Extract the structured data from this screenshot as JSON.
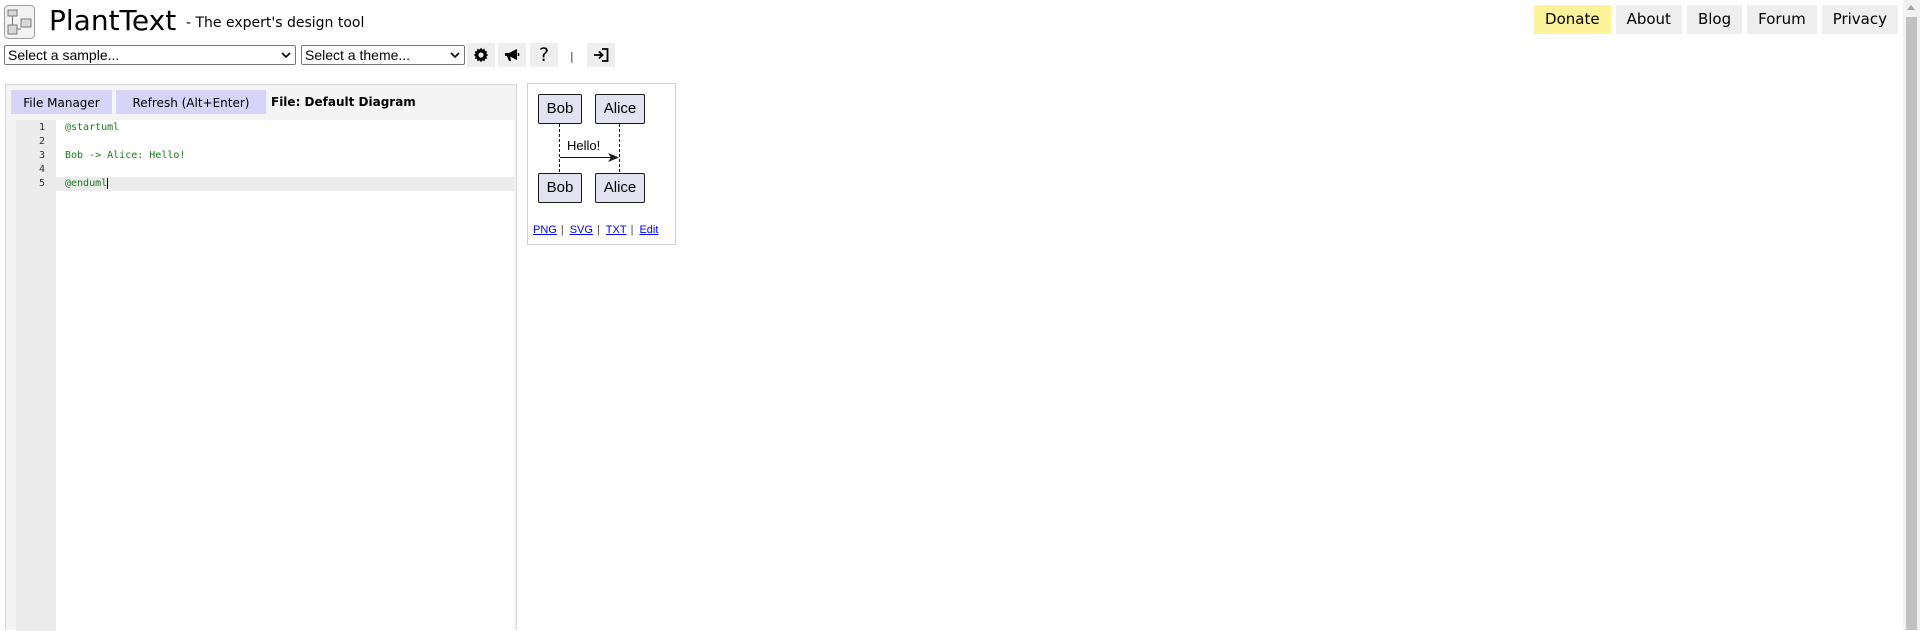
{
  "header": {
    "app_title": "PlantText",
    "tagline": "- The expert's design tool",
    "nav": [
      {
        "label": "Donate"
      },
      {
        "label": "About"
      },
      {
        "label": "Blog"
      },
      {
        "label": "Forum"
      },
      {
        "label": "Privacy"
      }
    ]
  },
  "toolbar": {
    "sample_select": "Select a sample...",
    "theme_select": "Select a theme...",
    "help_label": "?",
    "separator": "|",
    "icons": [
      "gear-icon",
      "megaphone-icon",
      "help-icon",
      "login-icon"
    ]
  },
  "editor": {
    "file_manager_label": "File Manager",
    "refresh_label": "Refresh (Alt+Enter)",
    "file_info": "File: Default Diagram",
    "lines": [
      {
        "num": "1",
        "text": "@startuml"
      },
      {
        "num": "2",
        "text": ""
      },
      {
        "num": "3",
        "text": "Bob -> Alice: Hello!"
      },
      {
        "num": "4",
        "text": ""
      },
      {
        "num": "5",
        "text": "@enduml"
      }
    ],
    "active_line": 5
  },
  "diagram": {
    "participants": [
      "Bob",
      "Alice"
    ],
    "message": "Hello!",
    "colors": {
      "participant_fill": "#e2e2f0",
      "line": "#181818"
    },
    "links": [
      "PNG",
      "SVG",
      "TXT",
      "Edit"
    ],
    "link_separator": "|"
  },
  "colors": {
    "donate": "#fdf39a",
    "nav_button": "#eeeeee",
    "editor_button": "#d8d4f7"
  }
}
